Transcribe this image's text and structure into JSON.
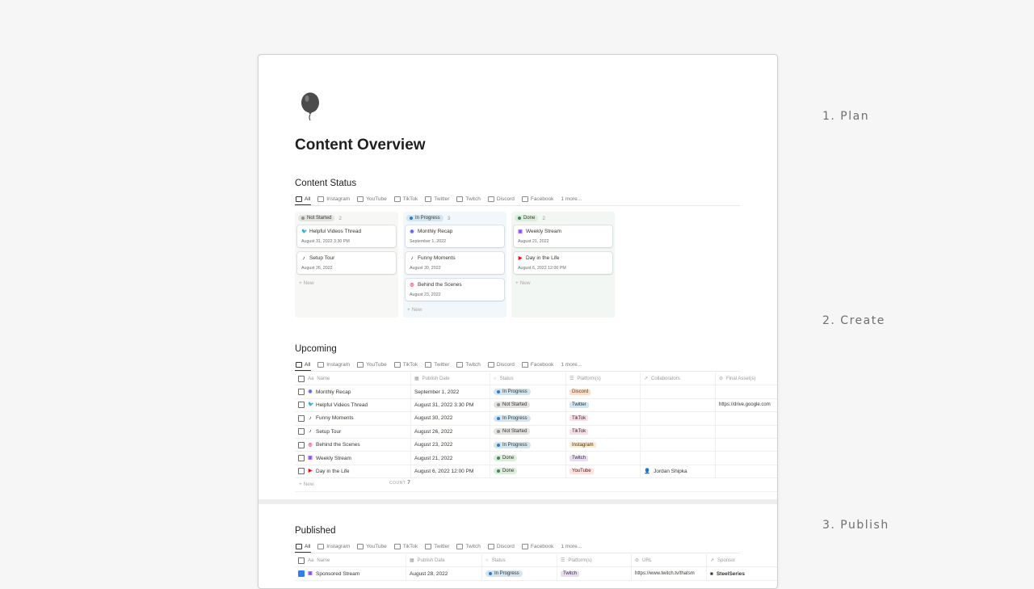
{
  "steps": [
    "1. Plan",
    "2. Create",
    "3. Publish"
  ],
  "page": {
    "title": "Content Overview",
    "icon": "balloon-icon"
  },
  "tabs": [
    {
      "label": "All",
      "active": true
    },
    {
      "label": "Instagram"
    },
    {
      "label": "YouTube"
    },
    {
      "label": "TikTok"
    },
    {
      "label": "Twitter"
    },
    {
      "label": "Twitch"
    },
    {
      "label": "Discord"
    },
    {
      "label": "Facebook"
    },
    {
      "label": "1 more..."
    }
  ],
  "colors": {
    "not_started_bg": "#e3e2e0",
    "in_progress_bg": "#d3e5ef",
    "done_bg": "#dbeddb"
  },
  "content_status": {
    "title": "Content Status",
    "new_label": "New",
    "columns": [
      {
        "status": "Not Started",
        "count": "2",
        "dot": "#91918e",
        "bg": "#f7f7f5",
        "pill_bg": "#e3e2e0",
        "cards": [
          {
            "title": "Helpful Videos Thread",
            "date": "August 31, 2022 3:30 PM",
            "platform": "twitter"
          },
          {
            "title": "Setup Tour",
            "date": "August 26, 2022",
            "platform": "tiktok"
          }
        ]
      },
      {
        "status": "In Progress",
        "count": "3",
        "dot": "#2e7cd1",
        "bg": "#f1f7fb",
        "pill_bg": "#d3e5ef",
        "cards": [
          {
            "title": "Monthly Recap",
            "date": "September 1, 2022",
            "platform": "discord"
          },
          {
            "title": "Funny Moments",
            "date": "August 30, 2022",
            "platform": "tiktok"
          },
          {
            "title": "Behind the Scenes",
            "date": "August 23, 2022",
            "platform": "instagram"
          }
        ]
      },
      {
        "status": "Done",
        "count": "2",
        "dot": "#448361",
        "bg": "#f2f7f3",
        "pill_bg": "#dbeddb",
        "cards": [
          {
            "title": "Weekly Stream",
            "date": "August 21, 2022",
            "platform": "twitch"
          },
          {
            "title": "Day in the Life",
            "date": "August 6, 2022 12:00 PM",
            "platform": "youtube"
          }
        ]
      }
    ]
  },
  "upcoming": {
    "title": "Upcoming",
    "headers": [
      "Name",
      "Publish Date",
      "Status",
      "Platform(s)",
      "Collaborators",
      "Final Asset(s)"
    ],
    "rows": [
      {
        "name": "Monthly Recap",
        "platform_icon": "discord",
        "date": "September 1, 2022",
        "status": "In Progress",
        "platform": "Discord",
        "collab": "",
        "asset": ""
      },
      {
        "name": "Helpful Videos Thread",
        "platform_icon": "twitter",
        "date": "August 31, 2022 3:30 PM",
        "status": "Not Started",
        "platform": "Twitter",
        "collab": "",
        "asset": "https://drive.google.com"
      },
      {
        "name": "Funny Moments",
        "platform_icon": "tiktok",
        "date": "August 30, 2022",
        "status": "In Progress",
        "platform": "TikTok",
        "collab": "",
        "asset": ""
      },
      {
        "name": "Setup Tour",
        "platform_icon": "tiktok",
        "date": "August 26, 2022",
        "status": "Not Started",
        "platform": "TikTok",
        "collab": "",
        "asset": ""
      },
      {
        "name": "Behind the Scenes",
        "platform_icon": "instagram",
        "date": "August 23, 2022",
        "status": "In Progress",
        "platform": "Instagram",
        "collab": "",
        "asset": ""
      },
      {
        "name": "Weekly Stream",
        "platform_icon": "twitch",
        "date": "August 21, 2022",
        "status": "Done",
        "platform": "Twitch",
        "collab": "",
        "asset": ""
      },
      {
        "name": "Day in the Life",
        "platform_icon": "youtube",
        "date": "August 6, 2022 12:00 PM",
        "status": "Done",
        "platform": "YouTube",
        "collab": "Jordan Shipka",
        "asset": ""
      }
    ],
    "new_label": "New",
    "count_label": "COUNT",
    "count_value": "7"
  },
  "published": {
    "title": "Published",
    "headers": [
      "Name",
      "Publish Date",
      "Status",
      "Platform(s)",
      "URL",
      "Sponsor"
    ],
    "rows": [
      {
        "name": "Sponsored Stream",
        "platform_icon": "twitch",
        "date": "August 28, 2022",
        "status": "In Progress",
        "platform": "Twitch",
        "url": "https://www.twitch.tv/thatsm",
        "sponsor": "SteelSeries",
        "checked": true
      }
    ]
  },
  "platform_tags": {
    "Discord": {
      "bg": "#fadec9",
      "fg": "#7a3e12"
    },
    "Twitter": {
      "bg": "#d3e5ef",
      "fg": "#183347"
    },
    "TikTok": {
      "bg": "#f5e0e9",
      "fg": "#4c2337"
    },
    "Instagram": {
      "bg": "#fdecc8",
      "fg": "#402c1b"
    },
    "Twitch": {
      "bg": "#e8deee",
      "fg": "#412454"
    },
    "YouTube": {
      "bg": "#ffe2dd",
      "fg": "#5d1715"
    }
  },
  "platform_icons": {
    "twitter": {
      "glyph": "🐦",
      "color": "#1d9bf0"
    },
    "tiktok": {
      "glyph": "♪",
      "color": "#111111"
    },
    "discord": {
      "glyph": "◉",
      "color": "#5865f2"
    },
    "instagram": {
      "glyph": "◎",
      "color": "#e1306c"
    },
    "twitch": {
      "glyph": "▣",
      "color": "#9146ff"
    },
    "youtube": {
      "glyph": "▶",
      "color": "#ff0000"
    }
  }
}
